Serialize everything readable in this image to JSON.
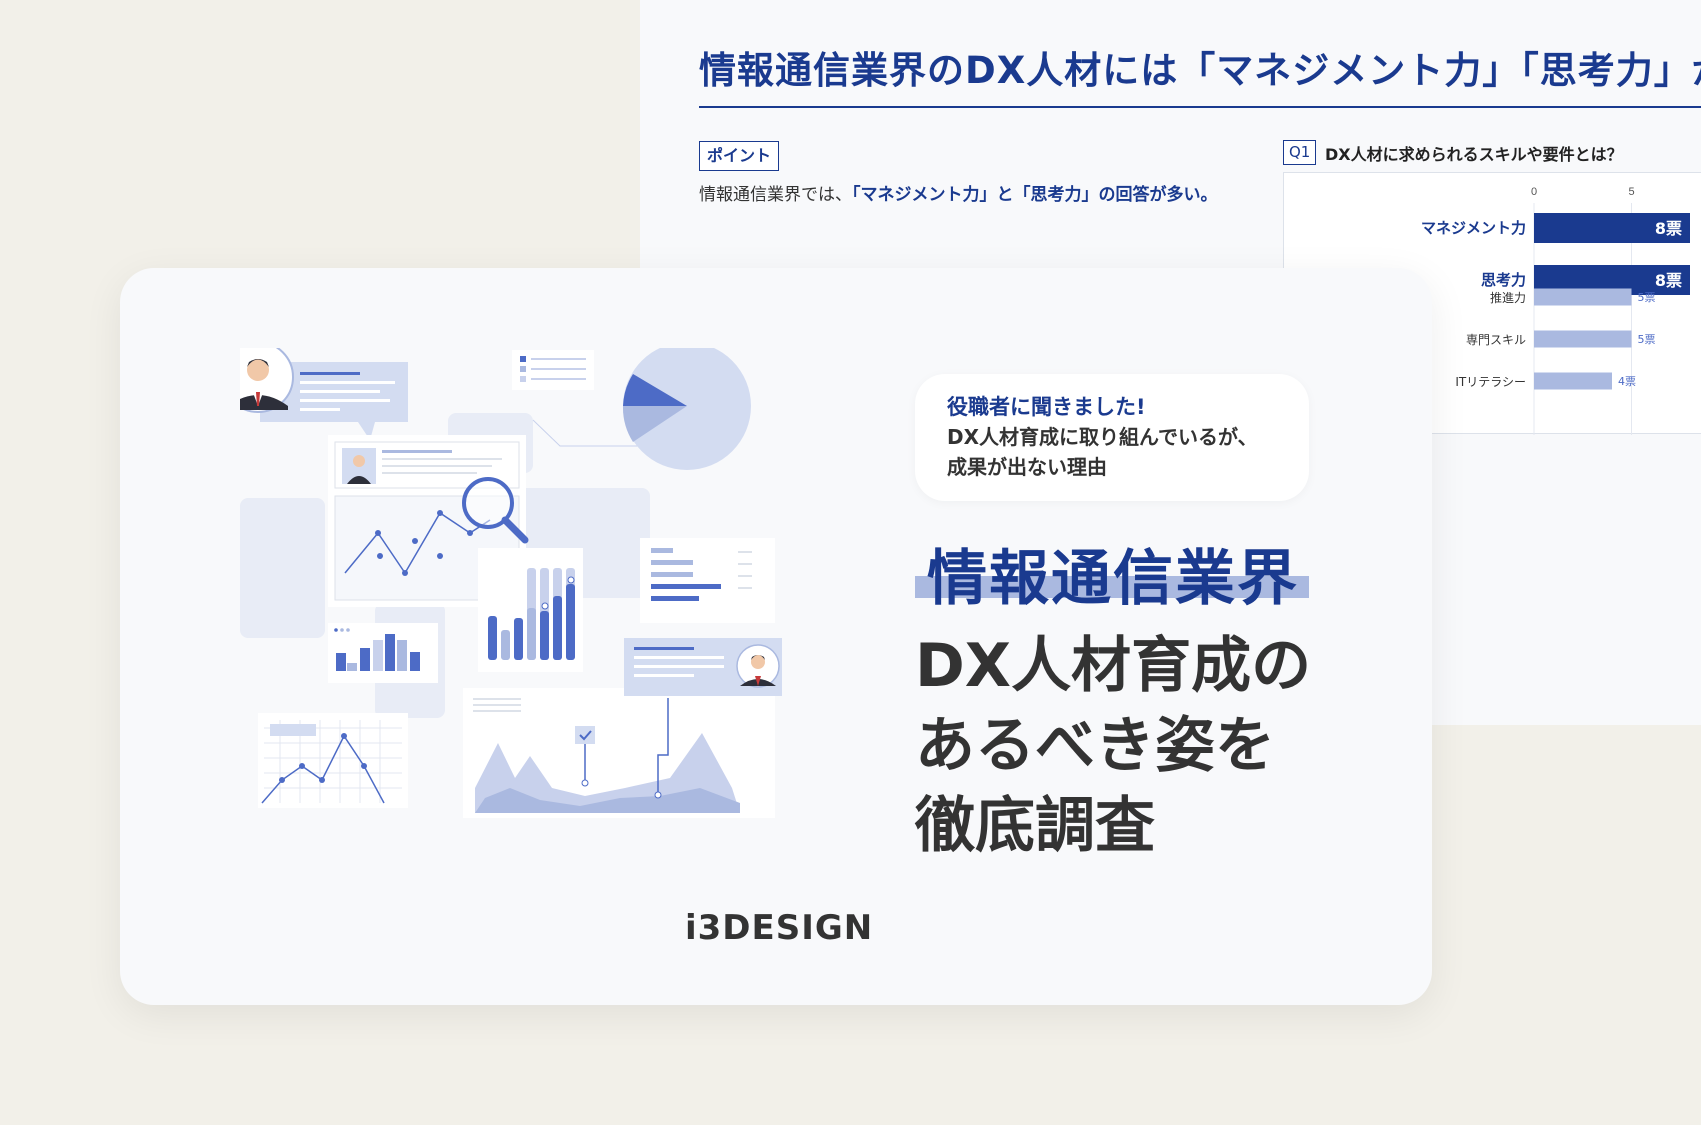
{
  "report": {
    "title": "情報通信業界のDX人材には「マネジメント力」「思考力」が求",
    "point_badge": "ポイント",
    "point_text_plain": "情報通信業界では、",
    "point_text_highlight": "「マネジメント力」と「思考力」の回答が多い。",
    "q_badge": "Q1",
    "q_text": "DX人材に求められるスキルや要件とは？"
  },
  "chart_data": {
    "type": "bar",
    "orientation": "horizontal",
    "categories": [
      "マネジメント力",
      "思考力",
      "推進力",
      "専門スキル",
      "ITリテラシー"
    ],
    "values": [
      8,
      8,
      5,
      5,
      4
    ],
    "value_labels": [
      "8票",
      "8票",
      "5票",
      "5票",
      "4票"
    ],
    "ticks": [
      "0",
      "5"
    ],
    "xlim": [
      0,
      8
    ],
    "highlight_colors": [
      "#1a3a8f",
      "#1a3a8f",
      "#aab9e0",
      "#aab9e0",
      "#aab9e0"
    ]
  },
  "card": {
    "speech_highlight": "役職者に聞きました!",
    "speech_line1": "DX人材育成に取り組んでいるが、",
    "speech_line2": "成果が出ない理由",
    "industry": "情報通信業界",
    "title_line1": "DX人材育成の",
    "title_line2": "あるべき姿を",
    "title_line3": "徹底調査",
    "logo": "i3DESIGN"
  },
  "colors": {
    "brand_navy": "#1a3a8f",
    "accent_light": "#aab9e0",
    "background": "#f2f0e9"
  }
}
